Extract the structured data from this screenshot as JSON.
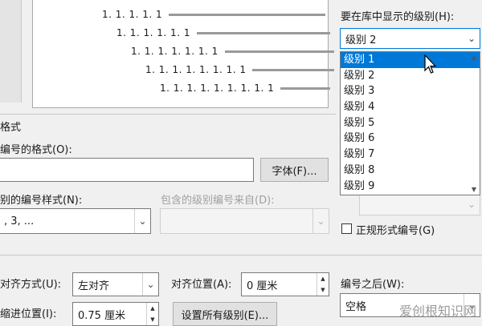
{
  "preview": {
    "rows": [
      {
        "label": "1. 1. 1. 1. 1"
      },
      {
        "label": "1. 1. 1. 1. 1. 1"
      },
      {
        "label": "1. 1. 1. 1. 1. 1. 1"
      },
      {
        "label": "1. 1. 1. 1. 1. 1. 1. 1"
      },
      {
        "label": "1. 1. 1. 1. 1. 1. 1. 1. 1"
      }
    ]
  },
  "library_level": {
    "label": "要在库中显示的级别(H):",
    "value": "级别 2",
    "options": [
      "级别 1",
      "级别 2",
      "级别 3",
      "级别 4",
      "级别 5",
      "级别 6",
      "级别 7",
      "级别 8",
      "级别 9"
    ],
    "highlighted_index": 0
  },
  "number_format_section": {
    "title": "格式",
    "format_label": "编号的格式(O):",
    "format_value": "",
    "font_button": "字体(F)...",
    "style_label": "别的编号样式(N):",
    "style_value": ", 3, ...",
    "include_label": "包含的级别编号来自(D):",
    "include_value": ""
  },
  "legal_style": {
    "label": "正规形式编号(G)",
    "checked": false
  },
  "alignment": {
    "align_label": "对齐方式(U):",
    "align_value": "左对齐",
    "position_label": "对齐位置(A):",
    "position_value": "0 厘米",
    "indent_label": "缩进位置(I):",
    "indent_value": "0.75 厘米",
    "set_all_button": "设置所有级别(E)...",
    "follow_label": "编号之后(W):",
    "follow_value": "空格"
  },
  "watermark": "爱创根知识网"
}
